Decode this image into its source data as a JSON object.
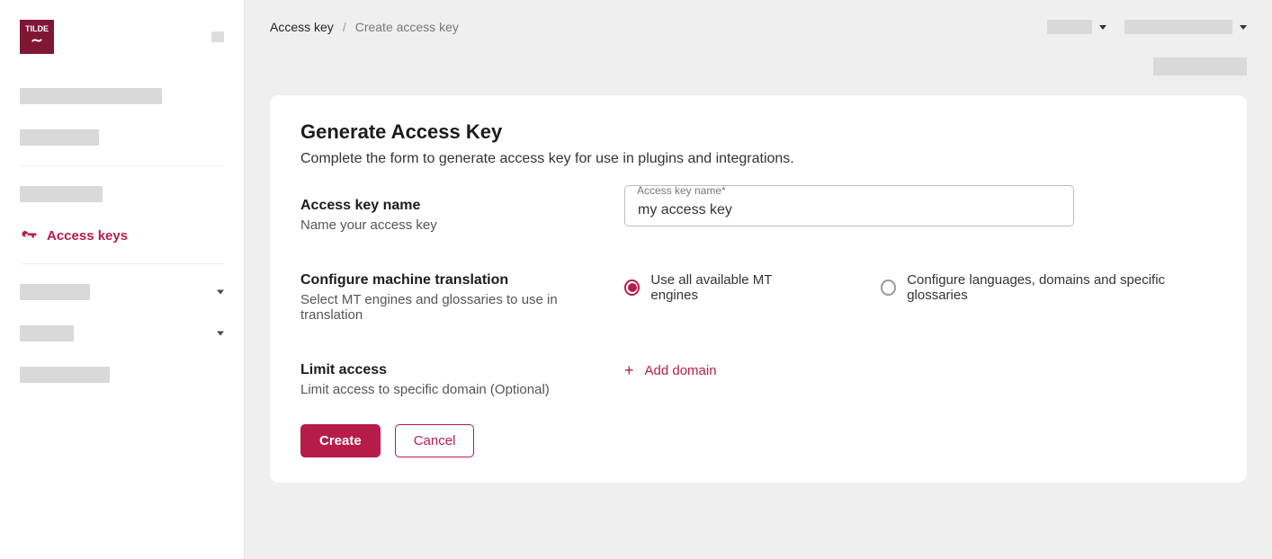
{
  "brand": {
    "name": "TILDE"
  },
  "sidebar": {
    "active_label": "Access keys"
  },
  "breadcrumb": {
    "root": "Access key",
    "current": "Create access key"
  },
  "card": {
    "title": "Generate Access Key",
    "subtitle": "Complete the form to generate access key for use in plugins and integrations."
  },
  "form": {
    "name": {
      "label": "Access key name",
      "help": "Name your access key",
      "float_label": "Access key name*",
      "value": "my access key"
    },
    "mt": {
      "label": "Configure machine translation",
      "help": "Select MT engines and glossaries to use in translation",
      "opt0": "Use all available MT engines",
      "opt1": "Configure languages, domains and specific glossaries",
      "selected": 0
    },
    "limit": {
      "label": "Limit access",
      "help": "Limit access to specific domain (Optional)",
      "add_label": "Add domain"
    }
  },
  "buttons": {
    "create": "Create",
    "cancel": "Cancel"
  }
}
